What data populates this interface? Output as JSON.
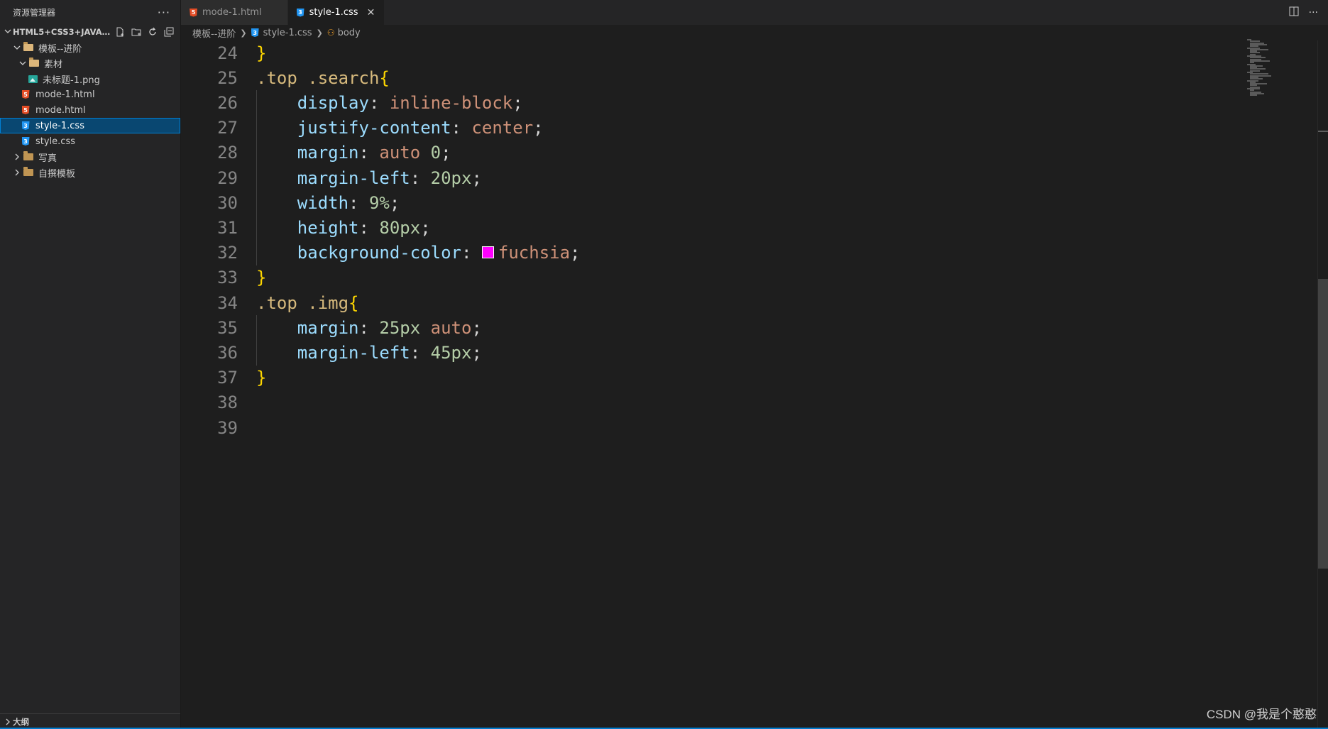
{
  "sidebar": {
    "title": "资源管理器",
    "more_label": "···",
    "workspace": "HTML5+CSS3+JAVASCRI...",
    "tree": [
      {
        "label": "模板--进阶",
        "type": "folder-open",
        "depth": 1
      },
      {
        "label": "素材",
        "type": "folder-open",
        "depth": 2
      },
      {
        "label": "未标题-1.png",
        "type": "image",
        "depth": 3
      },
      {
        "label": "mode-1.html",
        "type": "html",
        "depth": 2
      },
      {
        "label": "mode.html",
        "type": "html",
        "depth": 2
      },
      {
        "label": "style-1.css",
        "type": "css",
        "depth": 2,
        "selected": true
      },
      {
        "label": "style.css",
        "type": "css",
        "depth": 2
      },
      {
        "label": "写真",
        "type": "folder",
        "depth": 1
      },
      {
        "label": "自撰模板",
        "type": "folder",
        "depth": 1
      }
    ],
    "outline_label": "大纲"
  },
  "tabs": [
    {
      "label": "mode-1.html",
      "type": "html",
      "active": false
    },
    {
      "label": "style-1.css",
      "type": "css",
      "active": true
    }
  ],
  "breadcrumb": {
    "folder": "模板--进阶",
    "file": "style-1.css",
    "symbol": "body"
  },
  "code_lines": [
    {
      "n": "24",
      "tokens": [
        [
          "}",
          "brace"
        ]
      ]
    },
    {
      "n": "25",
      "tokens": [
        [
          ".top .search",
          "sel"
        ],
        [
          "{",
          "brace"
        ]
      ]
    },
    {
      "n": "26",
      "tokens": [
        [
          "    ",
          "punc"
        ],
        [
          "display",
          "prop"
        ],
        [
          ": ",
          "punc"
        ],
        [
          "inline-block",
          "val"
        ],
        [
          ";",
          "punc"
        ]
      ]
    },
    {
      "n": "27",
      "tokens": [
        [
          "    ",
          "punc"
        ],
        [
          "justify-content",
          "prop"
        ],
        [
          ": ",
          "punc"
        ],
        [
          "center",
          "val"
        ],
        [
          ";",
          "punc"
        ]
      ]
    },
    {
      "n": "28",
      "tokens": [
        [
          "    ",
          "punc"
        ],
        [
          "margin",
          "prop"
        ],
        [
          ": ",
          "punc"
        ],
        [
          "auto",
          "val"
        ],
        [
          " ",
          "punc"
        ],
        [
          "0",
          "num"
        ],
        [
          ";",
          "punc"
        ]
      ]
    },
    {
      "n": "29",
      "tokens": [
        [
          "    ",
          "punc"
        ],
        [
          "margin-left",
          "prop"
        ],
        [
          ": ",
          "punc"
        ],
        [
          "20px",
          "num"
        ],
        [
          ";",
          "punc"
        ]
      ]
    },
    {
      "n": "30",
      "tokens": [
        [
          "    ",
          "punc"
        ],
        [
          "width",
          "prop"
        ],
        [
          ": ",
          "punc"
        ],
        [
          "9%",
          "num"
        ],
        [
          ";",
          "punc"
        ]
      ]
    },
    {
      "n": "31",
      "tokens": [
        [
          "    ",
          "punc"
        ],
        [
          "height",
          "prop"
        ],
        [
          ": ",
          "punc"
        ],
        [
          "80px",
          "num"
        ],
        [
          ";",
          "punc"
        ]
      ]
    },
    {
      "n": "32",
      "tokens": [
        [
          "    ",
          "punc"
        ],
        [
          "background-color",
          "prop"
        ],
        [
          ": ",
          "punc"
        ],
        [
          "",
          "swatch"
        ],
        [
          "fuchsia",
          "val"
        ],
        [
          ";",
          "punc"
        ]
      ]
    },
    {
      "n": "33",
      "tokens": [
        [
          "}",
          "brace"
        ]
      ]
    },
    {
      "n": "34",
      "tokens": [
        [
          ".top .img",
          "sel"
        ],
        [
          "{",
          "brace"
        ]
      ]
    },
    {
      "n": "35",
      "tokens": [
        [
          "    ",
          "punc"
        ],
        [
          "margin",
          "prop"
        ],
        [
          ": ",
          "punc"
        ],
        [
          "25px",
          "num"
        ],
        [
          " ",
          "punc"
        ],
        [
          "auto",
          "val"
        ],
        [
          ";",
          "punc"
        ]
      ]
    },
    {
      "n": "36",
      "tokens": [
        [
          "    ",
          "punc"
        ],
        [
          "margin-left",
          "prop"
        ],
        [
          ": ",
          "punc"
        ],
        [
          "45px",
          "num"
        ],
        [
          ";",
          "punc"
        ]
      ]
    },
    {
      "n": "37",
      "tokens": [
        [
          "}",
          "brace"
        ]
      ]
    },
    {
      "n": "38",
      "tokens": []
    },
    {
      "n": "39",
      "tokens": []
    }
  ],
  "swatch_color": "#ff00ff",
  "watermark": "CSDN @我是个憨憨"
}
